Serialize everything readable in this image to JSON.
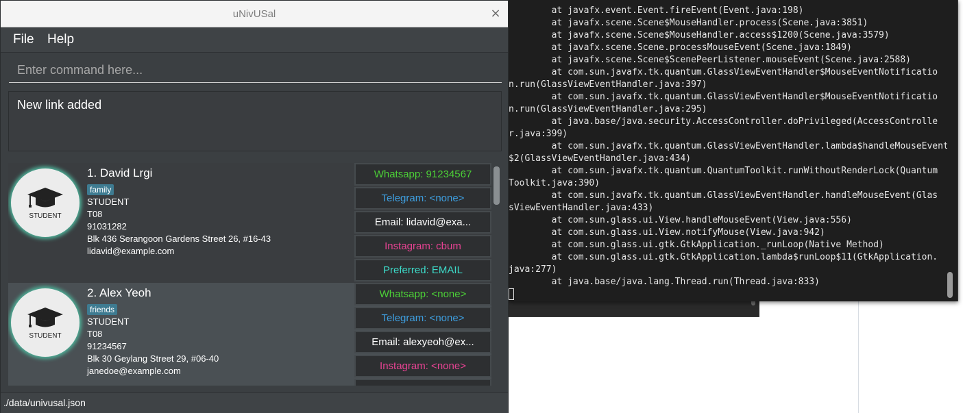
{
  "app": {
    "title": "uNivUSal",
    "close_glyph": "×",
    "menu": {
      "file": "File",
      "help": "Help"
    },
    "command": {
      "placeholder": "Enter command here...",
      "value": ""
    },
    "result": "New link added",
    "status_path": "./data/univusal.json",
    "avatar_caption": "STUDENT",
    "persons": [
      {
        "index_name": "1.  David Lrgi",
        "tag": "family",
        "role": "STUDENT",
        "tutorial": "T08",
        "phone": "91031282",
        "address": "Blk 436 Serangoon Gardens Street 26, #16-43",
        "email": "lidavid@example.com",
        "links": {
          "whatsapp": "Whatsapp: 91234567",
          "telegram": "Telegram: <none>",
          "email": "Email: lidavid@exa...",
          "instagram": "Instagram: cbum",
          "preferred": "Preferred: EMAIL"
        }
      },
      {
        "index_name": "2.  Alex Yeoh",
        "tag": "friends",
        "role": "STUDENT",
        "tutorial": "T08",
        "phone": "91234567",
        "address": "Blk 30 Geylang Street 29, #06-40",
        "email": "janedoe@example.com",
        "links": {
          "whatsapp": "Whatsapp: <none>",
          "telegram": "Telegram: <none>",
          "email": "Email: alexyeoh@ex...",
          "instagram": "Instagram: <none>"
        }
      }
    ]
  },
  "terminal": {
    "lines": [
      "        at javafx.event.Event.fireEvent(Event.java:198)",
      "        at javafx.scene.Scene$MouseHandler.process(Scene.java:3851)",
      "        at javafx.scene.Scene$MouseHandler.access$1200(Scene.java:3579)",
      "        at javafx.scene.Scene.processMouseEvent(Scene.java:1849)",
      "        at javafx.scene.Scene$ScenePeerListener.mouseEvent(Scene.java:2588)",
      "        at com.sun.javafx.tk.quantum.GlassViewEventHandler$MouseEventNotificatio",
      "n.run(GlassViewEventHandler.java:397)",
      "        at com.sun.javafx.tk.quantum.GlassViewEventHandler$MouseEventNotificatio",
      "n.run(GlassViewEventHandler.java:295)",
      "        at java.base/java.security.AccessController.doPrivileged(AccessControlle",
      "r.java:399)",
      "        at com.sun.javafx.tk.quantum.GlassViewEventHandler.lambda$handleMouseEvent",
      "$2(GlassViewEventHandler.java:434)",
      "        at com.sun.javafx.tk.quantum.QuantumToolkit.runWithoutRenderLock(Quantum",
      "Toolkit.java:390)",
      "        at com.sun.javafx.tk.quantum.GlassViewEventHandler.handleMouseEvent(Glas",
      "sViewEventHandler.java:433)",
      "        at com.sun.glass.ui.View.handleMouseEvent(View.java:556)",
      "        at com.sun.glass.ui.View.notifyMouse(View.java:942)",
      "        at com.sun.glass.ui.gtk.GtkApplication._runLoop(Native Method)",
      "        at com.sun.glass.ui.gtk.GtkApplication.lambda$runLoop$11(GtkApplication.",
      "java:277)",
      "        at java.base/java.lang.Thread.run(Thread.java:833)"
    ]
  },
  "colors": {
    "whatsapp": "#4cd137",
    "telegram": "#3e9fe0",
    "instagram": "#e84393",
    "preferred": "#3ddbc9",
    "email_link": "#ffffff",
    "avatar_glow": "#4fb39a",
    "tag_bg": "#3e7b91"
  }
}
